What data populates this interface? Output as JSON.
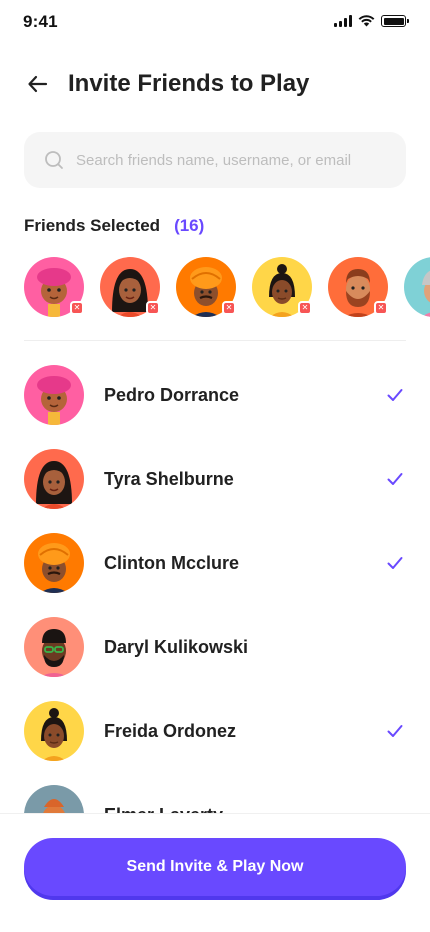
{
  "status_bar": {
    "time": "9:41"
  },
  "header": {
    "title": "Invite Friends to Play",
    "back_icon": "arrow-left-icon"
  },
  "search": {
    "placeholder": "Search friends name, username, or email",
    "value": ""
  },
  "selected": {
    "label": "Friends Selected",
    "count": "(16)"
  },
  "friends": [
    {
      "name": "Pedro Dorrance",
      "selected": true
    },
    {
      "name": "Tyra Shelburne",
      "selected": true
    },
    {
      "name": "Clinton Mcclure",
      "selected": true
    },
    {
      "name": "Daryl Kulikowski",
      "selected": false
    },
    {
      "name": "Freida Ordonez",
      "selected": true
    },
    {
      "name": "Elmer Laverty",
      "selected": false
    }
  ],
  "cta": {
    "label": "Send Invite & Play Now"
  },
  "colors": {
    "accent": "#6949ff",
    "remove_badge": "#f75555",
    "search_bg": "#f5f5f5"
  }
}
